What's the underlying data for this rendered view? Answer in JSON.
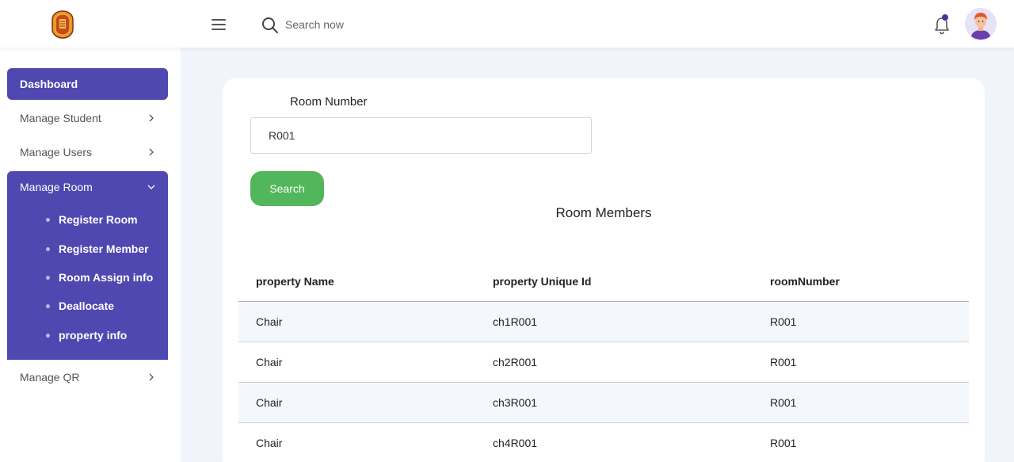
{
  "header": {
    "search_placeholder": "Search now"
  },
  "sidebar": {
    "items": [
      {
        "label": "Dashboard"
      },
      {
        "label": "Manage Student"
      },
      {
        "label": "Manage Users"
      },
      {
        "label": "Manage Room"
      },
      {
        "label": "Manage QR"
      }
    ],
    "room_subitems": [
      {
        "label": "Register Room"
      },
      {
        "label": "Register Member"
      },
      {
        "label": "Room Assign info"
      },
      {
        "label": "Deallocate"
      },
      {
        "label": "property info"
      }
    ]
  },
  "form": {
    "room_number_label": "Room Number",
    "room_number_value": "R001",
    "search_label": "Search"
  },
  "section": {
    "title": "Room Members"
  },
  "table": {
    "columns": [
      "property Name",
      "property Unique Id",
      "roomNumber"
    ],
    "rows": [
      [
        "Chair",
        "ch1R001",
        "R001"
      ],
      [
        "Chair",
        "ch2R001",
        "R001"
      ],
      [
        "Chair",
        "ch3R001",
        "R001"
      ],
      [
        "Chair",
        "ch4R001",
        "R001"
      ]
    ]
  },
  "colors": {
    "accent": "#4f48b0",
    "search_button": "#52b65a",
    "notification_dot": "#3d3a9e"
  },
  "icons": [
    "logo-emblem",
    "hamburger-menu-icon",
    "search-icon",
    "bell-icon",
    "chevron-right-icon",
    "chevron-down-icon",
    "user-avatar"
  ]
}
